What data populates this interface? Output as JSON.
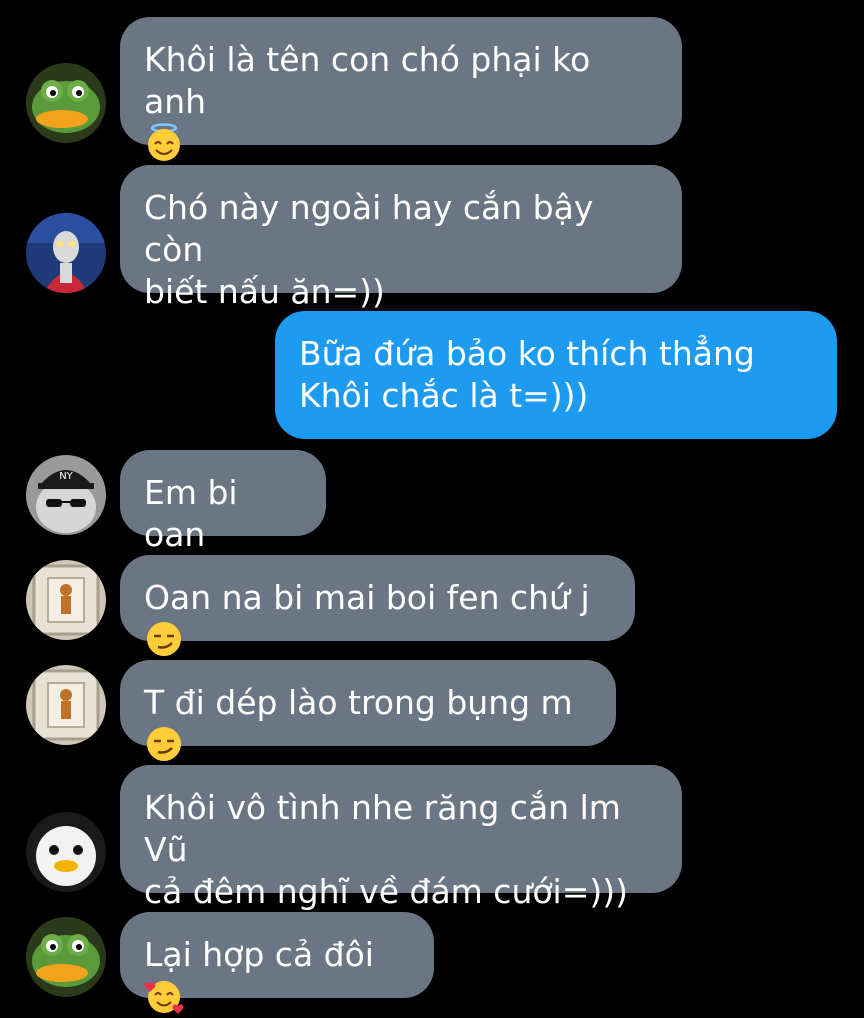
{
  "messages": [
    {
      "id": "m1",
      "direction": "incoming",
      "avatar_icon": "frog-avatar-icon",
      "text": "Khôi là tên con chó phại ko anh",
      "emoji": "smiling-face-with-halo"
    },
    {
      "id": "m2",
      "direction": "incoming",
      "avatar_icon": "ultraman-avatar-icon",
      "text": "Chó này ngoài hay cắn bậy còn\nbiết nấu ăn=))",
      "emoji": ""
    },
    {
      "id": "m3",
      "direction": "outgoing",
      "text": "Bữa đứa bảo ko thích thẳng\nKhôi chắc là t=)))",
      "emoji": ""
    },
    {
      "id": "m4",
      "direction": "incoming",
      "avatar_icon": "cat-with-cap-avatar-icon",
      "text": "Em bi oan",
      "emoji": ""
    },
    {
      "id": "m5",
      "direction": "incoming",
      "avatar_icon": "window-figure-avatar-icon",
      "text": "Oan na bi mai boi fen chứ j",
      "emoji": "smirking-face"
    },
    {
      "id": "m6",
      "direction": "incoming",
      "avatar_icon": "window-figure-avatar-icon",
      "text": "T đi dép lào trong bụng m",
      "emoji": "smirking-face"
    },
    {
      "id": "m7",
      "direction": "incoming",
      "avatar_icon": "white-duck-avatar-icon",
      "text": "Khôi vô tình nhe răng cắn lm Vũ\ncả đêm nghĩ về đám cưới=)))",
      "emoji": ""
    },
    {
      "id": "m8",
      "direction": "incoming",
      "avatar_icon": "frog-avatar-icon",
      "text": "Lại hợp cả đôi",
      "emoji": "smiling-face-with-hearts"
    }
  ],
  "colors": {
    "background": "#000000",
    "incoming_bubble": "#6b7684",
    "outgoing_bubble": "#1d9bf0",
    "text": "#ffffff"
  }
}
